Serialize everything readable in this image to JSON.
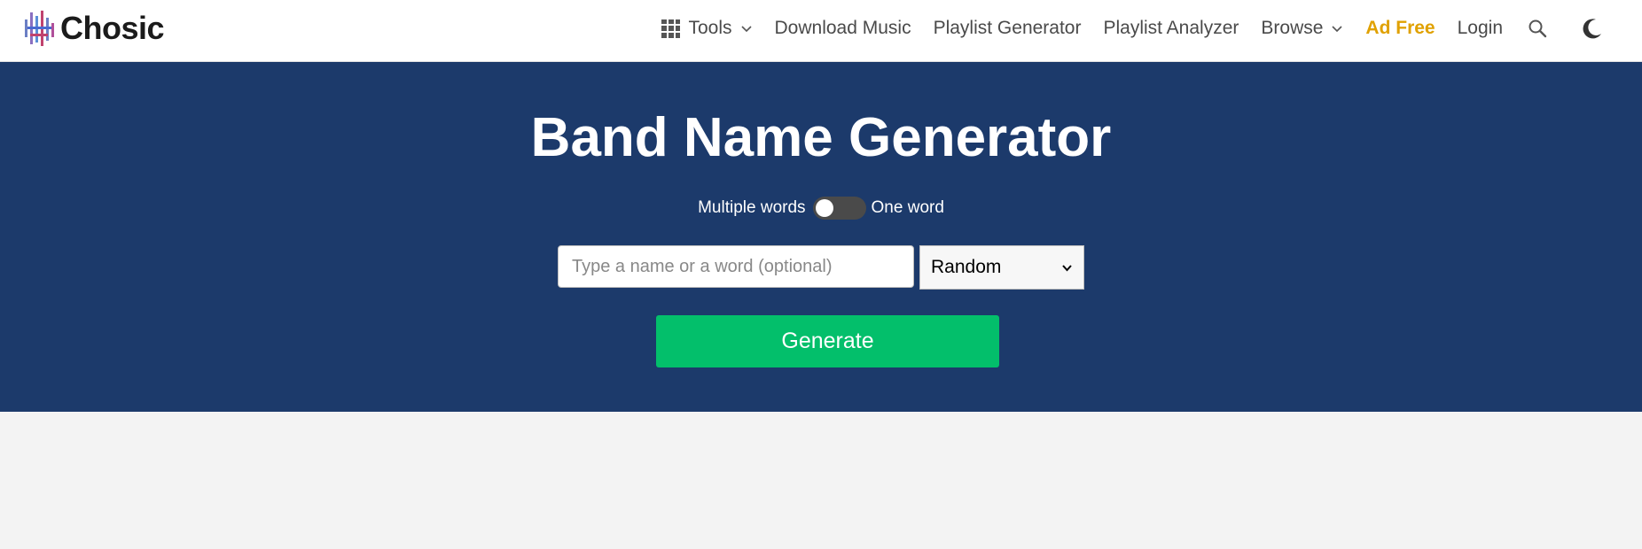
{
  "header": {
    "logo_text": "Chosic",
    "nav": {
      "tools": "Tools",
      "download_music": "Download Music",
      "playlist_generator": "Playlist Generator",
      "playlist_analyzer": "Playlist Analyzer",
      "browse": "Browse",
      "ad_free": "Ad Free",
      "login": "Login"
    },
    "icons": [
      "grid-icon",
      "chevron-down-icon",
      "search-icon",
      "moon-icon"
    ]
  },
  "hero": {
    "title": "Band Name Generator",
    "toggle": {
      "left_label": "Multiple words",
      "right_label": "One word",
      "state": "off"
    },
    "input": {
      "placeholder": "Type a name or a word (optional)",
      "value": ""
    },
    "select": {
      "selected": "Random"
    },
    "generate_label": "Generate"
  },
  "colors": {
    "hero_bg": "#1c3a6b",
    "generate_bg": "#03bf6b",
    "ad_free": "#e0a100",
    "page_bg": "#f3f3f3"
  }
}
